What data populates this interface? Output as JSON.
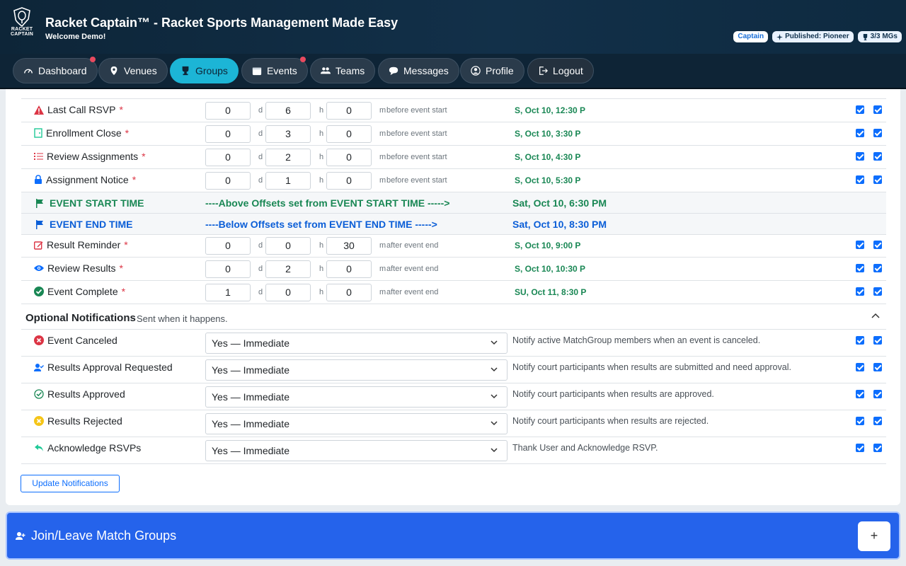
{
  "app": {
    "logo_text_1": "RACKET",
    "logo_text_2": "CAPTAIN",
    "title": "Racket Captain™ - Racket Sports Management Made Easy",
    "welcome": "Welcome Demo!"
  },
  "badges": {
    "captain": "Captain",
    "published": "Published: Pioneer",
    "mgs": "3/3 MGs"
  },
  "nav": {
    "dashboard": "Dashboard",
    "venues": "Venues",
    "groups": "Groups",
    "events": "Events",
    "teams": "Teams",
    "messages": "Messages",
    "profile": "Profile",
    "logout": "Logout"
  },
  "before_rows": [
    {
      "label": "Last Call RSVP",
      "d": "0",
      "h": "6",
      "m": "0",
      "relation": "before event start",
      "datetime": "S, Oct 10, 12:30 P"
    },
    {
      "label": "Enrollment Close",
      "d": "0",
      "h": "3",
      "m": "0",
      "relation": "before event start",
      "datetime": "S, Oct 10, 3:30 P"
    },
    {
      "label": "Review Assignments",
      "d": "0",
      "h": "2",
      "m": "0",
      "relation": "before event start",
      "datetime": "S, Oct 10, 4:30 P"
    },
    {
      "label": "Assignment Notice",
      "d": "0",
      "h": "1",
      "m": "0",
      "relation": "before event start",
      "datetime": "S, Oct 10, 5:30 P"
    }
  ],
  "event_start": {
    "label": "EVENT START TIME",
    "message": "----Above Offsets set from EVENT START TIME ----->",
    "time": "Sat, Oct 10, 6:30 PM"
  },
  "event_end": {
    "label": "EVENT END TIME",
    "message": "----Below Offsets set from EVENT END TIME ----->",
    "time": "Sat, Oct 10, 8:30 PM"
  },
  "after_rows": [
    {
      "label": "Result Reminder",
      "d": "0",
      "h": "0",
      "m": "30",
      "relation": "after event end",
      "datetime": "S, Oct 10, 9:00 P"
    },
    {
      "label": "Review Results",
      "d": "0",
      "h": "2",
      "m": "0",
      "relation": "after event end",
      "datetime": "S, Oct 10, 10:30 P"
    },
    {
      "label": "Event Complete",
      "d": "1",
      "h": "0",
      "m": "0",
      "relation": "after event end",
      "datetime": "SU, Oct 11, 8:30 P"
    }
  ],
  "units": {
    "d": "d",
    "h": "h",
    "m": "m"
  },
  "required_mark": "*",
  "optional": {
    "title": "Optional Notifications",
    "subtitle": "Sent when it happens.",
    "rows": [
      {
        "label": "Event Canceled",
        "value": "Yes — Immediate",
        "description": "Notify active MatchGroup members when an event is canceled."
      },
      {
        "label": "Results Approval Requested",
        "value": "Yes — Immediate",
        "description": "Notify court participants when results are submitted and need approval."
      },
      {
        "label": "Results Approved",
        "value": "Yes — Immediate",
        "description": "Notify court participants when results are approved."
      },
      {
        "label": "Results Rejected",
        "value": "Yes — Immediate",
        "description": "Notify court participants when results are rejected."
      },
      {
        "label": "Acknowledge RSVPs",
        "value": "Yes — Immediate",
        "description": "Thank User and Acknowledge RSVP."
      }
    ]
  },
  "update_button": "Update Notifications",
  "join": {
    "title": "Join/Leave Match Groups",
    "plus": "+"
  },
  "colors": {
    "accent": "#1cb5d6",
    "primary": "#0d6efd",
    "success": "#198754",
    "danger": "#dc3545"
  }
}
